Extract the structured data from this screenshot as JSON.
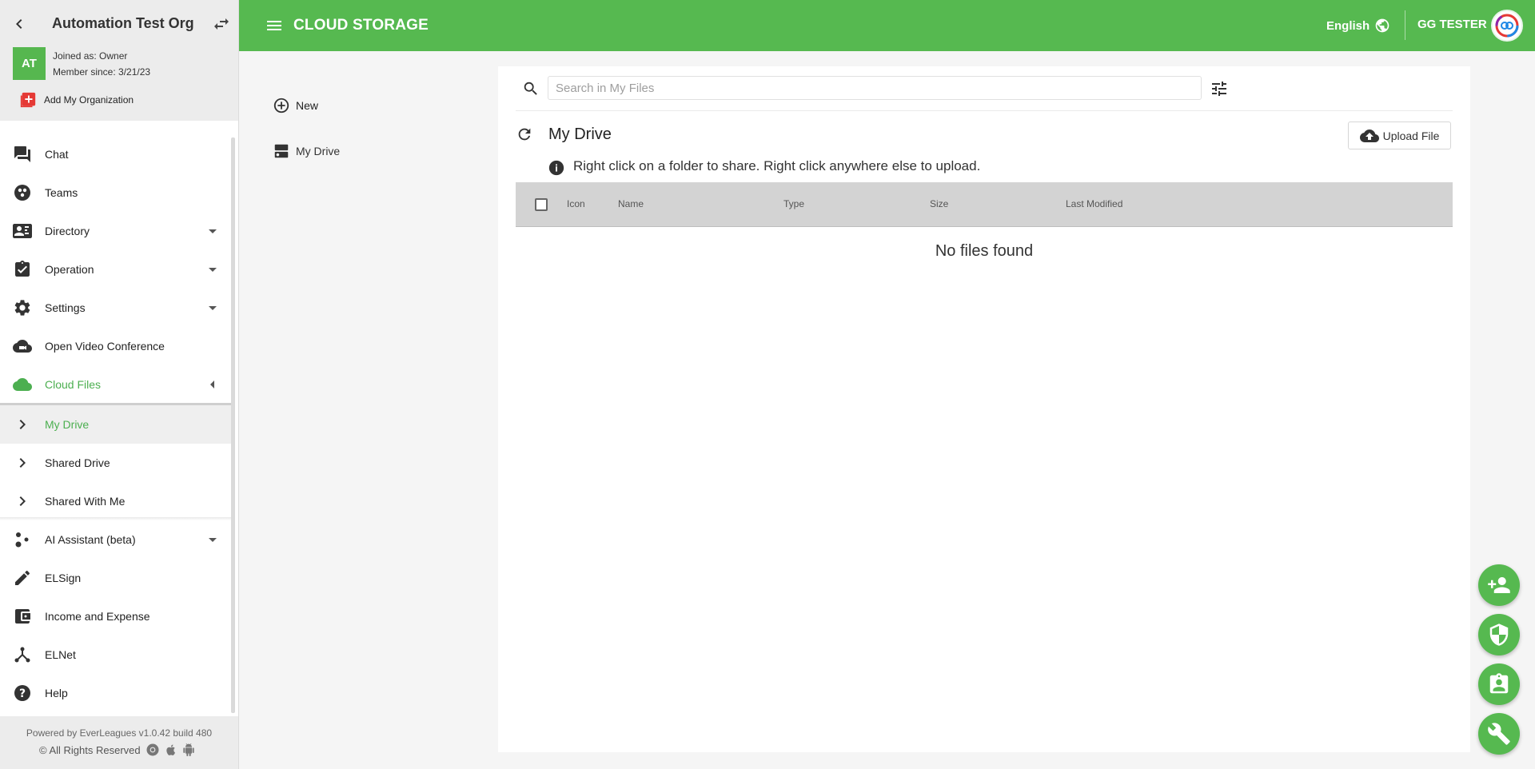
{
  "org": {
    "name": "Automation Test Org",
    "avatar_initials": "AT",
    "role": "Joined as: Owner",
    "member_since": "Member since: 3/21/23",
    "add_org_label": "Add My Organization"
  },
  "nav": {
    "items": [
      {
        "label": "Chat",
        "icon": "chat-icon"
      },
      {
        "label": "Teams",
        "icon": "teams-icon"
      },
      {
        "label": "Directory",
        "icon": "contact-card-icon",
        "has_dropdown": true
      },
      {
        "label": "Operation",
        "icon": "clipboard-check-icon",
        "has_dropdown": true
      },
      {
        "label": "Settings",
        "icon": "gear-icon",
        "has_dropdown": true
      },
      {
        "label": "Open Video Conference",
        "icon": "cloud-video-icon"
      },
      {
        "label": "Cloud Files",
        "icon": "cloud-icon",
        "expanded": true,
        "active": true
      },
      {
        "label": "My Drive",
        "icon": "chevron-right-icon",
        "sub": true,
        "selected": true
      },
      {
        "label": "Shared Drive",
        "icon": "chevron-right-icon",
        "sub": true
      },
      {
        "label": "Shared With Me",
        "icon": "chevron-right-icon",
        "sub": true
      },
      {
        "label": "AI Assistant (beta)",
        "icon": "ai-dots-icon",
        "has_dropdown": true
      },
      {
        "label": "ELSign",
        "icon": "pencil-icon"
      },
      {
        "label": "Income and Expense",
        "icon": "wallet-icon"
      },
      {
        "label": "ELNet",
        "icon": "network-icon"
      },
      {
        "label": "Help",
        "icon": "help-icon"
      }
    ]
  },
  "footer": {
    "powered_by": "Powered by EverLeagues v1.0.42 build 480",
    "rights": "© All Rights Reserved"
  },
  "topbar": {
    "title": "CLOUD STORAGE",
    "language": "English",
    "user_name": "GG TESTER"
  },
  "drive_nav": {
    "new_label": "New",
    "my_drive_label": "My Drive"
  },
  "main": {
    "search_placeholder": "Search in My Files",
    "search_value": "",
    "title": "My Drive",
    "upload_label": "Upload File",
    "info_text": "Right click on a folder to share. Right click anywhere else to upload.",
    "columns": [
      "Icon",
      "Name",
      "Type",
      "Size",
      "Last Modified"
    ],
    "empty_message": "No files found"
  },
  "fabs": [
    "add-user-icon",
    "shield-icon",
    "badge-icon",
    "wrench-icon"
  ],
  "colors": {
    "brand_green": "#56b950",
    "active_text": "#4caf50",
    "table_header": "#d3d3d3"
  }
}
